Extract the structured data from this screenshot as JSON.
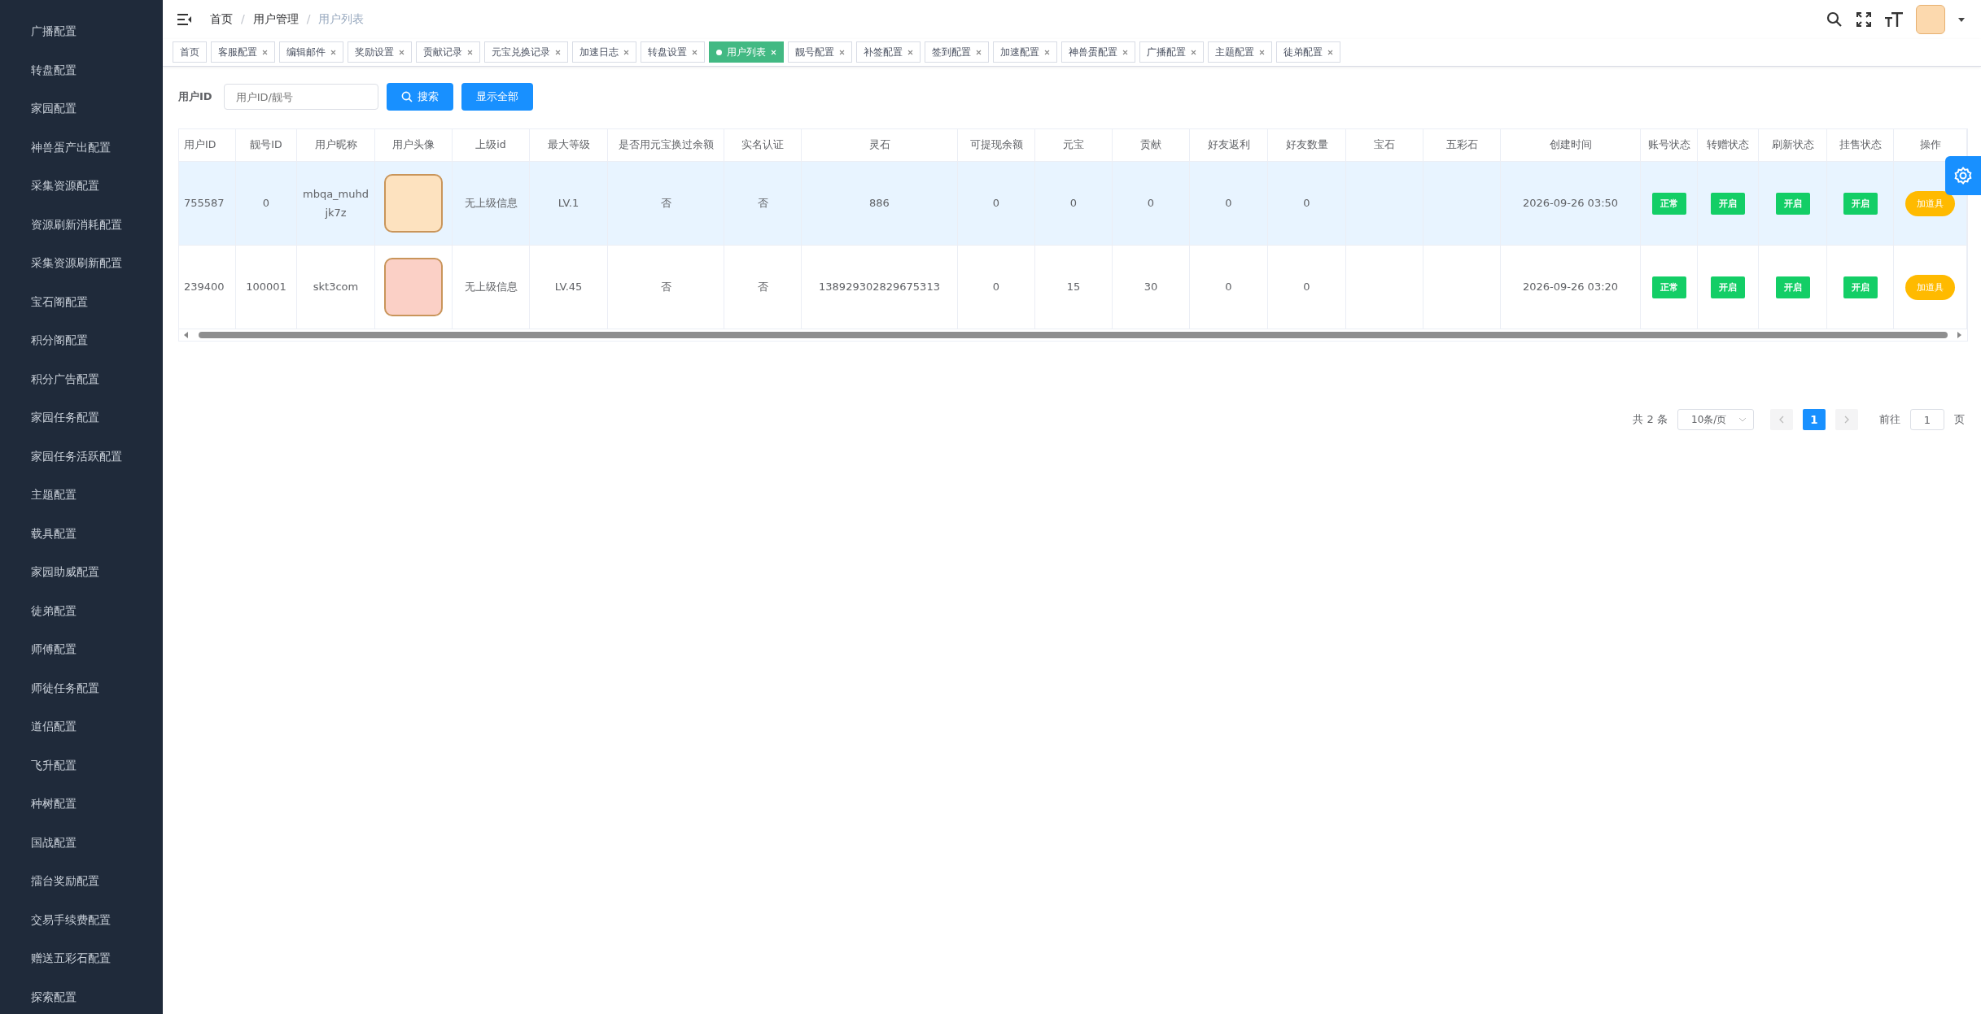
{
  "sidebar": {
    "items": [
      "广播配置",
      "转盘配置",
      "家园配置",
      "神兽蛋产出配置",
      "采集资源配置",
      "资源刷新消耗配置",
      "采集资源刷新配置",
      "宝石阁配置",
      "积分阁配置",
      "积分广告配置",
      "家园任务配置",
      "家园任务活跃配置",
      "主题配置",
      "载具配置",
      "家园助威配置",
      "徒弟配置",
      "师傅配置",
      "师徒任务配置",
      "道侣配置",
      "飞升配置",
      "种树配置",
      "国战配置",
      "擂台奖励配置",
      "交易手续费配置",
      "赠送五彩石配置",
      "探索配置"
    ]
  },
  "breadcrumb": [
    {
      "label": "首页",
      "current": false
    },
    {
      "separator": "/",
      "label": "用户管理",
      "current": false
    },
    {
      "separator": "/",
      "label": "用户列表",
      "current": true
    }
  ],
  "tabs": [
    {
      "label": "首页",
      "selected": false,
      "closable": false
    },
    {
      "label": "客服配置",
      "selected": false,
      "closable": true
    },
    {
      "label": "编辑邮件",
      "selected": false,
      "closable": true
    },
    {
      "label": "奖励设置",
      "selected": false,
      "closable": true
    },
    {
      "label": "贡献记录",
      "selected": false,
      "closable": true
    },
    {
      "label": "元宝兑换记录",
      "selected": false,
      "closable": true
    },
    {
      "label": "加速日志",
      "selected": false,
      "closable": true
    },
    {
      "label": "转盘设置",
      "selected": false,
      "closable": true
    },
    {
      "label": "用户列表",
      "selected": true,
      "closable": true
    },
    {
      "label": "靓号配置",
      "selected": false,
      "closable": true
    },
    {
      "label": "补签配置",
      "selected": false,
      "closable": true
    },
    {
      "label": "签到配置",
      "selected": false,
      "closable": true
    },
    {
      "label": "加速配置",
      "selected": false,
      "closable": true
    },
    {
      "label": "神兽蛋配置",
      "selected": false,
      "closable": true
    },
    {
      "label": "广播配置",
      "selected": false,
      "closable": true
    },
    {
      "label": "主题配置",
      "selected": false,
      "closable": true
    },
    {
      "label": "徒弟配置",
      "selected": false,
      "closable": true
    }
  ],
  "search": {
    "label": "用户ID",
    "placeholder": "用户ID/靓号",
    "buttons": [
      {
        "label": "搜索",
        "kind": "search"
      },
      {
        "label": "显示全部",
        "kind": "plain"
      }
    ]
  },
  "table": {
    "columns": [
      "用户ID",
      "靓号ID",
      "用户昵称",
      "用户头像",
      "上级id",
      "最大等级",
      "是否用元宝换过余额",
      "实名认证",
      "灵石",
      "可提现余额",
      "元宝",
      "贡献",
      "好友返利",
      "好友数量",
      "宝石",
      "五彩石",
      "创建时间",
      "账号状态",
      "转赠状态",
      "刷新状态",
      "挂售状态",
      "操作"
    ],
    "rows": [
      {
        "selected": true,
        "cells": [
          {
            "kind": "text",
            "text": "755587"
          },
          {
            "kind": "text",
            "text": "0"
          },
          {
            "kind": "text",
            "text": "mbqa_muhdjk7z"
          },
          {
            "kind": "avatar",
            "color": "#fde2bf"
          },
          {
            "kind": "text",
            "text": "无上级信息"
          },
          {
            "kind": "text",
            "text": "LV.1"
          },
          {
            "kind": "text",
            "text": "否"
          },
          {
            "kind": "text",
            "text": "否"
          },
          {
            "kind": "text",
            "text": "886"
          },
          {
            "kind": "text",
            "text": "0"
          },
          {
            "kind": "text",
            "text": "0"
          },
          {
            "kind": "text",
            "text": "0"
          },
          {
            "kind": "text",
            "text": "0"
          },
          {
            "kind": "text",
            "text": "0"
          },
          {
            "kind": "empty"
          },
          {
            "kind": "empty"
          },
          {
            "kind": "text",
            "text": "2026-09-26 03:50"
          },
          {
            "kind": "status",
            "text": "正常"
          },
          {
            "kind": "status",
            "text": "开启"
          },
          {
            "kind": "status",
            "text": "开启"
          },
          {
            "kind": "status",
            "text": "开启"
          },
          {
            "kind": "action",
            "text": "加道具"
          }
        ]
      },
      {
        "selected": false,
        "cells": [
          {
            "kind": "text",
            "text": "239400"
          },
          {
            "kind": "text",
            "text": "100001"
          },
          {
            "kind": "text",
            "text": "skt3com"
          },
          {
            "kind": "avatar",
            "color": "#fbd0c6"
          },
          {
            "kind": "text",
            "text": "无上级信息"
          },
          {
            "kind": "text",
            "text": "LV.45"
          },
          {
            "kind": "text",
            "text": "否"
          },
          {
            "kind": "text",
            "text": "否"
          },
          {
            "kind": "text",
            "text": "138929302829675313"
          },
          {
            "kind": "text",
            "text": "0"
          },
          {
            "kind": "text",
            "text": "15"
          },
          {
            "kind": "text",
            "text": "30"
          },
          {
            "kind": "text",
            "text": "0"
          },
          {
            "kind": "text",
            "text": "0"
          },
          {
            "kind": "empty"
          },
          {
            "kind": "empty"
          },
          {
            "kind": "text",
            "text": "2026-09-26 03:20"
          },
          {
            "kind": "status",
            "text": "正常"
          },
          {
            "kind": "status",
            "text": "开启"
          },
          {
            "kind": "status",
            "text": "开启"
          },
          {
            "kind": "status",
            "text": "开启"
          },
          {
            "kind": "action",
            "text": "加道具"
          }
        ]
      }
    ]
  },
  "pagination": {
    "total": "共 2 条",
    "page_size": "10条/页",
    "pages": [
      {
        "label": "1",
        "selected": true
      }
    ],
    "goto_label": "前往",
    "goto_value": "1",
    "goto_suffix": "页"
  }
}
